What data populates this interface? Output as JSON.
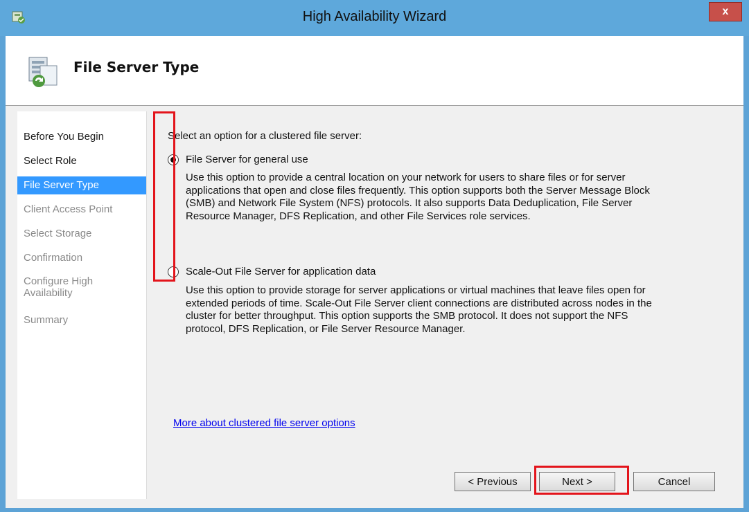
{
  "window": {
    "title": "High Availability Wizard",
    "close_label": "x",
    "colors": {
      "title_bar": "#5ea8db",
      "close": "#c7504a",
      "selection": "#3399ff",
      "highlight": "#e3141b"
    }
  },
  "header": {
    "title": "File Server Type",
    "icon": "cluster-server-wizard-icon"
  },
  "nav": {
    "items": [
      {
        "label": "Before You Begin",
        "state": "enabled"
      },
      {
        "label": "Select Role",
        "state": "enabled"
      },
      {
        "label": "File Server Type",
        "state": "selected"
      },
      {
        "label": "Client Access Point",
        "state": "disabled"
      },
      {
        "label": "Select Storage",
        "state": "disabled"
      },
      {
        "label": "Confirmation",
        "state": "disabled"
      },
      {
        "label": "Configure High",
        "label_line2": "Availability",
        "state": "disabled"
      },
      {
        "label": "Summary",
        "state": "disabled"
      }
    ]
  },
  "content": {
    "prompt": "Select an option for a clustered file server:",
    "options": [
      {
        "label": "File Server for general use",
        "selected": true,
        "description_lines": [
          "Use this option to provide a central location on your network for users to share files or for server",
          "applications that open and close files frequently. This option supports both the Server Message Block",
          "(SMB) and Network File System (NFS) protocols. It also supports Data Deduplication, File Server",
          "Resource Manager, DFS Replication, and other File Services role services."
        ]
      },
      {
        "label": "Scale-Out File Server for application data",
        "selected": false,
        "description_lines": [
          "Use this option to provide storage for server applications or virtual machines that leave files open for",
          "extended periods of time. Scale-Out File Server client connections are distributed across nodes in the",
          "cluster for better throughput. This option supports the SMB protocol. It does not support the NFS",
          "protocol, DFS Replication, or File Server Resource Manager."
        ]
      }
    ],
    "link": "More about clustered file server options"
  },
  "buttons": {
    "previous": "< Previous",
    "next": "Next >",
    "cancel": "Cancel"
  }
}
